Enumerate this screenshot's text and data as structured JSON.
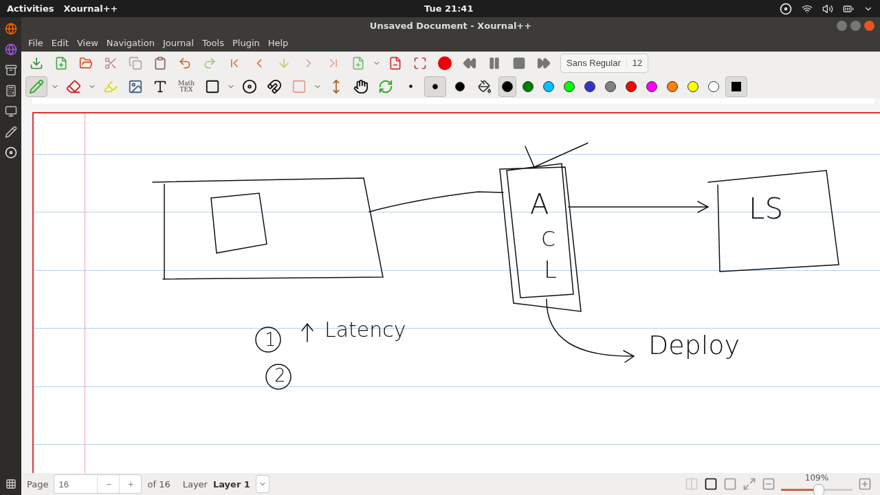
{
  "top_bar": {
    "activities": "Activities",
    "app": "Xournal++",
    "clock": "Tue 21:41"
  },
  "window": {
    "title": "Unsaved Document - Xournal++"
  },
  "menu": [
    "File",
    "Edit",
    "View",
    "Navigation",
    "Journal",
    "Tools",
    "Plugin",
    "Help"
  ],
  "tools": [
    {
      "kind": "pen",
      "selected": true
    },
    {
      "kind": "eraser",
      "selected": false
    },
    {
      "kind": "highlighter",
      "selected": false
    },
    {
      "kind": "image",
      "selected": false
    },
    {
      "kind": "text",
      "selected": false
    },
    {
      "kind": "math",
      "label": "Math TEX",
      "selected": false
    },
    {
      "kind": "shape",
      "selected": false
    },
    {
      "kind": "rotate",
      "selected": false
    },
    {
      "kind": "snap",
      "selected": false
    },
    {
      "kind": "select",
      "selected": false
    },
    {
      "kind": "space",
      "selected": false
    },
    {
      "kind": "hand",
      "selected": false
    },
    {
      "kind": "refresh",
      "selected": false
    }
  ],
  "sizes": [
    {
      "kind": "fine",
      "selected": false
    },
    {
      "kind": "medium",
      "selected": true
    }
  ],
  "font": {
    "name": "Sans Regular",
    "size": "12"
  },
  "colors": [
    {
      "color": "#000000",
      "selected": true
    },
    {
      "color": "#008000",
      "selected": false
    },
    {
      "color": "#00c0ff",
      "selected": false
    },
    {
      "color": "#00ff00",
      "selected": false
    },
    {
      "color": "#3333cc",
      "selected": false
    },
    {
      "color": "#808080",
      "selected": false
    },
    {
      "color": "#ff0000",
      "selected": false
    },
    {
      "color": "#ff00ff",
      "selected": false
    },
    {
      "color": "#ff8000",
      "selected": false
    },
    {
      "color": "#ffff00",
      "selected": false
    },
    {
      "color": "#ffffff",
      "selected": false
    }
  ],
  "handwriting": [
    {
      "text": "A"
    },
    {
      "text": "C"
    },
    {
      "text": "L"
    },
    {
      "text": "LS"
    },
    {
      "text": "Latency"
    },
    {
      "text": "Deploy"
    },
    {
      "text": "1"
    },
    {
      "text": "2"
    }
  ],
  "status": {
    "page_label": "Page",
    "page": "16",
    "minus": "−",
    "plus": "+",
    "page_total": "of 16",
    "layer_label": "Layer",
    "layer": "Layer 1",
    "zoom": "109%",
    "zoom_slider": {
      "level": 0.52
    }
  }
}
